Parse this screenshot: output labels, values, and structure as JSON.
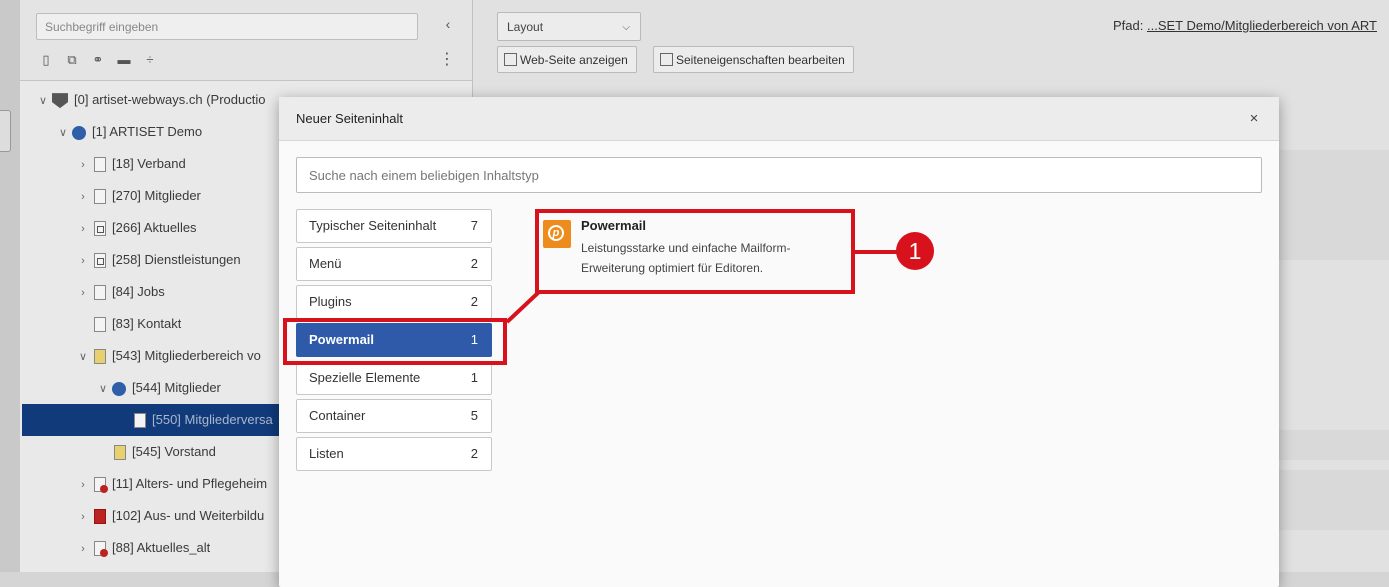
{
  "tree": {
    "search_placeholder": "Suchbegriff eingeben",
    "collapse_symbol": "‹",
    "toolbar_icons": [
      "new-page-icon",
      "new-shortcut-icon",
      "new-link-icon",
      "new-folder-icon",
      "divider-icon"
    ],
    "more_symbol": "⋮",
    "nodes": [
      {
        "label": "[0] artiset-webways.ch (Productio",
        "expander": "∨",
        "icon": "typo3-logo-icon"
      },
      {
        "label": "[1] ARTISET Demo",
        "expander": "∨",
        "icon": "globe-icon"
      },
      {
        "label": "[18] Verband",
        "expander": "›",
        "icon": "page-icon"
      },
      {
        "label": "[270] Mitglieder",
        "expander": "›",
        "icon": "page-icon"
      },
      {
        "label": "[266] Aktuelles",
        "expander": "›",
        "icon": "shortcut-page-icon"
      },
      {
        "label": "[258] Dienstleistungen",
        "expander": "›",
        "icon": "shortcut-page-icon"
      },
      {
        "label": "[84] Jobs",
        "expander": "›",
        "icon": "page-icon"
      },
      {
        "label": "[83] Kontakt",
        "expander": "",
        "icon": "page-icon"
      },
      {
        "label": "[543] Mitgliederbereich vo",
        "expander": "∨",
        "icon": "member-page-icon"
      },
      {
        "label": "[544] Mitglieder",
        "expander": "∨",
        "icon": "globe-icon"
      },
      {
        "label": "[550] Mitgliederversa",
        "expander": "",
        "icon": "page-icon"
      },
      {
        "label": "[545] Vorstand",
        "expander": "",
        "icon": "member-page-icon"
      },
      {
        "label": "[11] Alters- und Pflegeheim",
        "expander": "›",
        "icon": "restricted-page-icon"
      },
      {
        "label": "[102] Aus- und Weiterbildu",
        "expander": "›",
        "icon": "red-folder-icon"
      },
      {
        "label": "[88] Aktuelles_alt",
        "expander": "›",
        "icon": "restricted-page-icon"
      }
    ]
  },
  "header": {
    "layout_select": "Layout",
    "path_label": "Pfad:",
    "path_value": "...SET Demo/Mitgliederbereich von ART",
    "view_button": "Web-Seite anzeigen",
    "edit_button": "Seiteneigenschaften bearbeiten"
  },
  "modal": {
    "title": "Neuer Seiteninhalt",
    "close_symbol": "×",
    "search_placeholder": "Suche nach einem beliebigen Inhaltstyp",
    "categories": [
      {
        "label": "Typischer Seiteninhalt",
        "count": "7"
      },
      {
        "label": "Menü",
        "count": "2"
      },
      {
        "label": "Plugins",
        "count": "2"
      },
      {
        "label": "Powermail",
        "count": "1"
      },
      {
        "label": "Spezielle Elemente",
        "count": "1"
      },
      {
        "label": "Container",
        "count": "5"
      },
      {
        "label": "Listen",
        "count": "2"
      }
    ],
    "active_category": "Powermail",
    "element": {
      "title": "Powermail",
      "description": "Leistungsstarke und einfache Mailform-Erweiterung optimiert für Editoren.",
      "icon_letter": "p",
      "icon_color": "#ed8c1c"
    }
  },
  "annotation": {
    "badge": "1",
    "color": "#d7121c"
  },
  "colors": {
    "active_category": "#2f5aa9",
    "tree_selected": "#103a7a"
  }
}
